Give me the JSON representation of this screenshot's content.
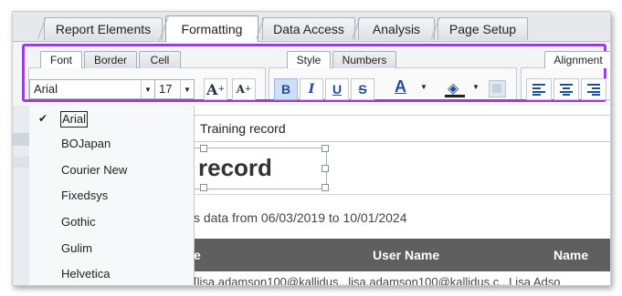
{
  "main_tabs": [
    "Report Elements",
    "Formatting",
    "Data Access",
    "Analysis",
    "Page Setup"
  ],
  "sub_tabs_left": [
    "Font",
    "Border",
    "Cell"
  ],
  "sub_tabs_mid": [
    "Style",
    "Numbers"
  ],
  "sub_tab_right": "Alignment",
  "font": {
    "value": "Arial",
    "size": "17"
  },
  "font_options": [
    "Arial",
    "BOJapan",
    "Courier New",
    "Fixedsys",
    "Gothic",
    "Gulim",
    "Helvetica"
  ],
  "toolbar": {
    "bold": "B",
    "italic": "I",
    "underline": "U",
    "strike": "S",
    "font_color": "A",
    "grow": "A",
    "shrink": "A"
  },
  "report": {
    "title_input": "Training record",
    "title_text": "record",
    "description": "s data from 06/03/2019 to 10/01/2024",
    "columns": [
      "e",
      "User Name",
      "Name"
    ],
    "row_text": "[lisa.adamson100@kallidus...lisa.adamson100@kallidus.c...Lisa Adso"
  },
  "colors": {
    "highlight": "#9b3be0",
    "table_header": "#5f5f5f",
    "active_button": "#cfe0f6"
  }
}
